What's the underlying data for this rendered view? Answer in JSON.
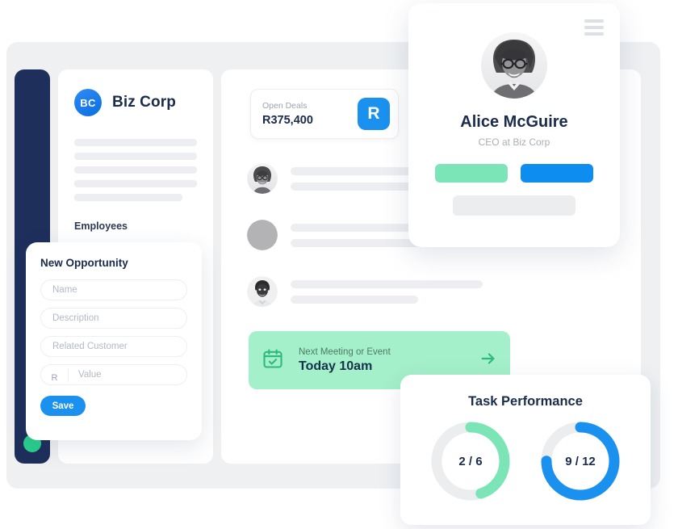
{
  "app": {
    "window_name": "crm-dashboard"
  },
  "nav_rail": {
    "status_dot_name": "status-dot"
  },
  "company_panel": {
    "logo_initials": "BC",
    "company_name": "Biz Corp",
    "employees_label": "Employees",
    "skeleton_line_widths": [
      "100%",
      "100%",
      "100%",
      "100%",
      "88%"
    ],
    "employee_count_shown": 5
  },
  "deals_card": {
    "label": "Open Deals",
    "value": "R375,400",
    "icon_glyph": "R",
    "icon_color": "#1b91ef"
  },
  "contacts": [
    {
      "avatar": "woman-glasses-avatar",
      "line1_width": 196,
      "line2_width": 196
    },
    {
      "avatar": "placeholder-avatar",
      "line1_width": 196,
      "line2_width": 218
    },
    {
      "avatar": "man-avatar",
      "line1_width": 238,
      "line2_width": 158
    }
  ],
  "meeting_banner": {
    "subtitle": "Next Meeting or Event",
    "title": "Today 10am",
    "icon": "calendar-check-icon",
    "arrow": "→",
    "background": "#a4f0ca"
  },
  "profile_card": {
    "menu_icon": "hamburger-menu-icon",
    "avatar": "alice-avatar",
    "name": "Alice McGuire",
    "role": "CEO at Biz Corp",
    "primary_action_color": "#7be5b8",
    "secondary_action_color": "#0d8df0"
  },
  "opportunity_form": {
    "title": "New Opportunity",
    "fields": [
      {
        "name": "name-field",
        "placeholder": "Name"
      },
      {
        "name": "description-field",
        "placeholder": "Description"
      },
      {
        "name": "related-customer-field",
        "placeholder": "Related Customer"
      }
    ],
    "currency_prefix": "R",
    "value_placeholder": "Value",
    "save_label": "Save"
  },
  "task_performance": {
    "title": "Task Performance",
    "accent_green": "#7be5b8",
    "accent_blue": "#1b91ef",
    "track_color": "#ebedef"
  },
  "chart_data": [
    {
      "type": "pie",
      "title": "Task Performance",
      "subtype": "donut",
      "name": "tasks-green",
      "label": "2 / 6",
      "completed": 2,
      "total": 6,
      "percent": 45,
      "color": "#7be5b8",
      "track": "#ebedef"
    },
    {
      "type": "pie",
      "title": "Task Performance",
      "subtype": "donut",
      "name": "tasks-blue",
      "label": "9 / 12",
      "completed": 9,
      "total": 12,
      "percent": 75,
      "color": "#1b91ef",
      "track": "#ebedef"
    }
  ]
}
